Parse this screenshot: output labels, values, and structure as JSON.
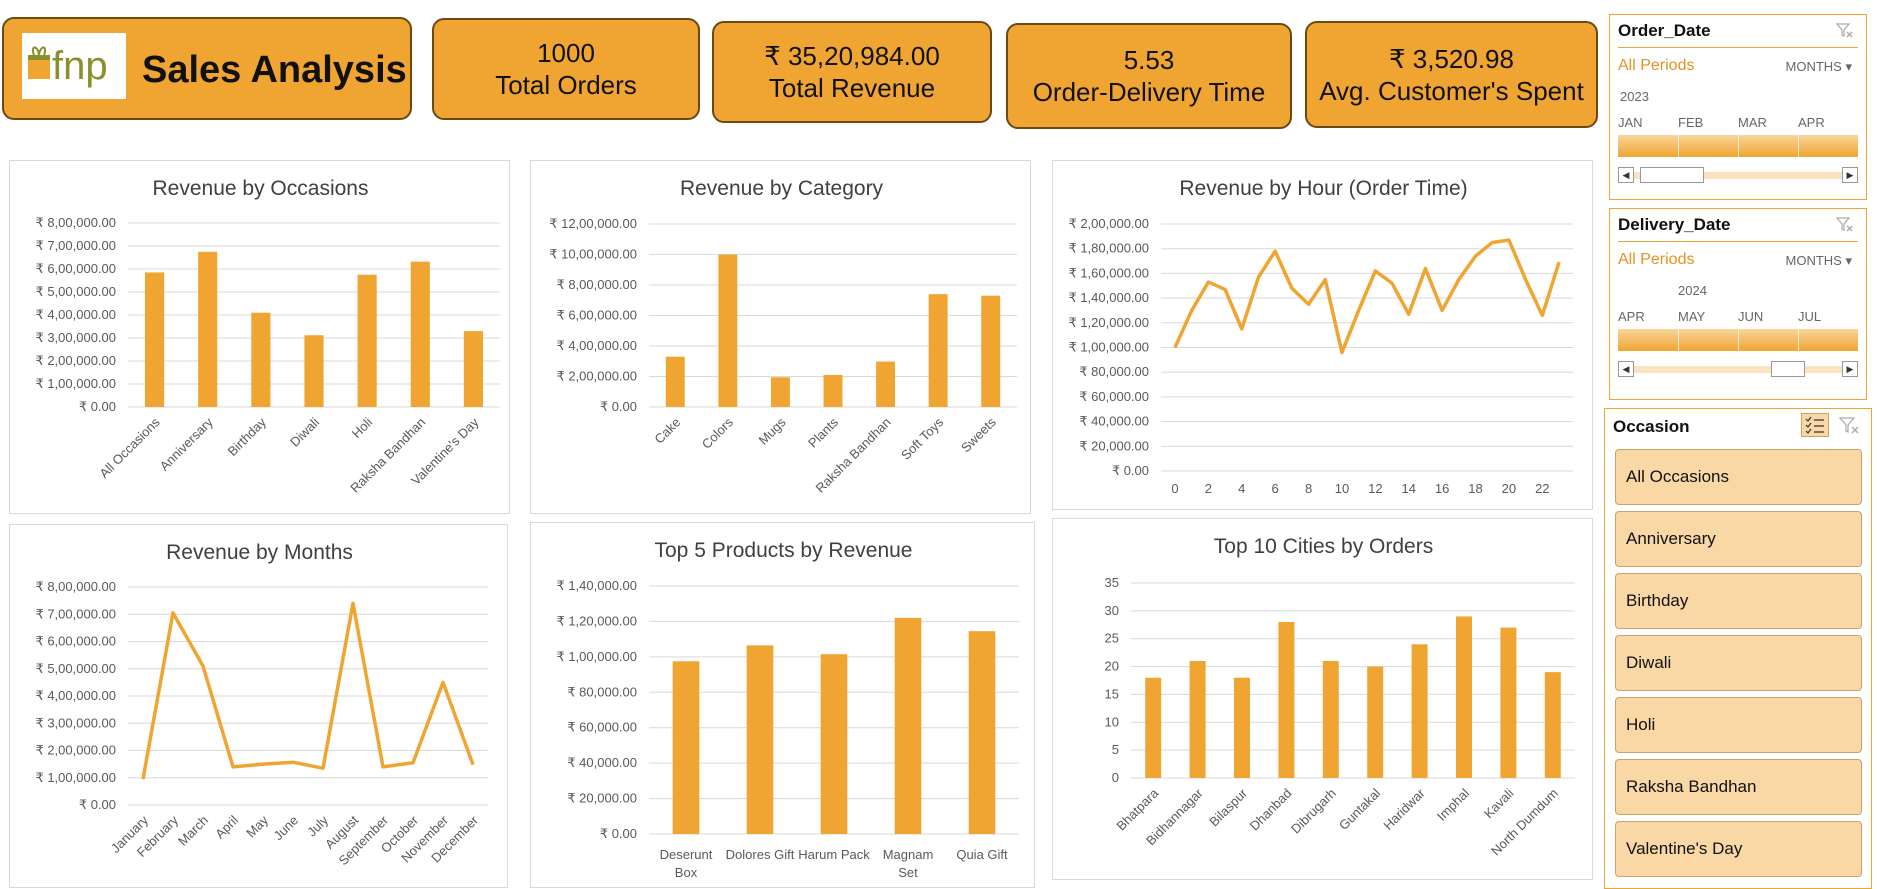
{
  "header": {
    "logo_text": "fnp",
    "title": "Sales Analysis"
  },
  "kpis": [
    {
      "value": "1000",
      "label": "Total Orders"
    },
    {
      "value": "₹ 35,20,984.00",
      "label": "Total Revenue"
    },
    {
      "value": "5.53",
      "label": "Order-Delivery Time"
    },
    {
      "value": "₹ 3,520.98",
      "label": "Avg. Customer's Spent"
    }
  ],
  "slicers": {
    "order_date": {
      "title": "Order_Date",
      "period": "All Periods",
      "unit": "MONTHS",
      "year": "2023",
      "months": [
        "JAN",
        "FEB",
        "MAR",
        "APR"
      ]
    },
    "delivery_date": {
      "title": "Delivery_Date",
      "period": "All Periods",
      "unit": "MONTHS",
      "year": "2024",
      "months": [
        "APR",
        "MAY",
        "JUN",
        "JUL"
      ]
    },
    "occasion": {
      "title": "Occasion",
      "items": [
        "All Occasions",
        "Anniversary",
        "Birthday",
        "Diwali",
        "Holi",
        "Raksha Bandhan",
        "Valentine's Day"
      ]
    }
  },
  "colors": {
    "accent": "#f0a532",
    "border": "#6b4a12",
    "slicer_item": "#f9d8a6"
  },
  "chart_data": [
    {
      "id": "occasions",
      "type": "bar",
      "title": "Revenue by Occasions",
      "categories": [
        "All Occasions",
        "Anniversary",
        "Birthday",
        "Diwali",
        "Holi",
        "Raksha Bandhan",
        "Valentine's Day"
      ],
      "values": [
        585000,
        675000,
        410000,
        312000,
        575000,
        632000,
        330000
      ],
      "ylim": [
        0,
        800000
      ],
      "yticks": [
        "₹ 0.00",
        "₹ 1,00,000.00",
        "₹ 2,00,000.00",
        "₹ 3,00,000.00",
        "₹ 4,00,000.00",
        "₹ 5,00,000.00",
        "₹ 6,00,000.00",
        "₹ 7,00,000.00",
        "₹ 8,00,000.00"
      ]
    },
    {
      "id": "category",
      "type": "bar",
      "title": "Revenue by Category",
      "categories": [
        "Cake",
        "Colors",
        "Mugs",
        "Plants",
        "Raksha Bandhan",
        "Soft Toys",
        "Sweets"
      ],
      "values": [
        330000,
        1000000,
        195000,
        210000,
        298000,
        740000,
        730000
      ],
      "ylim": [
        0,
        1200000
      ],
      "yticks": [
        "₹ 0.00",
        "₹ 2,00,000.00",
        "₹ 4,00,000.00",
        "₹ 6,00,000.00",
        "₹ 8,00,000.00",
        "₹ 10,00,000.00",
        "₹ 12,00,000.00"
      ]
    },
    {
      "id": "hour",
      "type": "line",
      "title": "Revenue by Hour (Order Time)",
      "x": [
        0,
        1,
        2,
        3,
        4,
        5,
        6,
        7,
        8,
        9,
        10,
        11,
        12,
        13,
        14,
        15,
        16,
        17,
        18,
        19,
        20,
        21,
        22,
        23
      ],
      "values": [
        100000,
        130000,
        153000,
        147000,
        115000,
        157000,
        178000,
        148000,
        135000,
        155000,
        96000,
        130000,
        162000,
        152000,
        127000,
        164000,
        130000,
        155000,
        174000,
        185000,
        187000,
        155000,
        126000,
        169000
      ],
      "ylim": [
        0,
        200000
      ],
      "xticks": [
        "0",
        "2",
        "4",
        "6",
        "8",
        "10",
        "12",
        "14",
        "16",
        "18",
        "20",
        "22"
      ],
      "yticks": [
        "₹ 0.00",
        "₹ 20,000.00",
        "₹ 40,000.00",
        "₹ 60,000.00",
        "₹ 80,000.00",
        "₹ 1,00,000.00",
        "₹ 1,20,000.00",
        "₹ 1,40,000.00",
        "₹ 1,60,000.00",
        "₹ 1,80,000.00",
        "₹ 2,00,000.00"
      ]
    },
    {
      "id": "months",
      "type": "line",
      "title": "Revenue by Months",
      "categories": [
        "January",
        "February",
        "March",
        "April",
        "May",
        "June",
        "July",
        "August",
        "September",
        "October",
        "November",
        "December"
      ],
      "values": [
        95000,
        705000,
        510000,
        140000,
        150000,
        157000,
        135000,
        740000,
        140000,
        155000,
        450000,
        148000
      ],
      "ylim": [
        0,
        800000
      ],
      "yticks": [
        "₹ 0.00",
        "₹ 1,00,000.00",
        "₹ 2,00,000.00",
        "₹ 3,00,000.00",
        "₹ 4,00,000.00",
        "₹ 5,00,000.00",
        "₹ 6,00,000.00",
        "₹ 7,00,000.00",
        "₹ 8,00,000.00"
      ]
    },
    {
      "id": "products",
      "type": "bar",
      "title": "Top 5 Products by Revenue",
      "categories": [
        [
          "Deserunt",
          "Box"
        ],
        [
          "Dolores Gift"
        ],
        [
          "Harum Pack"
        ],
        [
          "Magnam",
          "Set"
        ],
        [
          "Quia Gift"
        ]
      ],
      "values": [
        97500,
        106500,
        101500,
        122000,
        114500
      ],
      "ylim": [
        0,
        140000
      ],
      "yticks": [
        "₹ 0.00",
        "₹ 20,000.00",
        "₹ 40,000.00",
        "₹ 60,000.00",
        "₹ 80,000.00",
        "₹ 1,00,000.00",
        "₹ 1,20,000.00",
        "₹ 1,40,000.00"
      ]
    },
    {
      "id": "cities",
      "type": "bar",
      "title": "Top 10 Cities by Orders",
      "categories": [
        "Bhatpara",
        "Bidhannagar",
        "Bilaspur",
        "Dhanbad",
        "Dibrugarh",
        "Guntakal",
        "Haridwar",
        "Imphal",
        "Kavali",
        "North Dumdum"
      ],
      "values": [
        18,
        21,
        18,
        28,
        21,
        20,
        24,
        29,
        27,
        19
      ],
      "ylim": [
        0,
        35
      ],
      "yticks": [
        "0",
        "5",
        "10",
        "15",
        "20",
        "25",
        "30",
        "35"
      ]
    }
  ]
}
